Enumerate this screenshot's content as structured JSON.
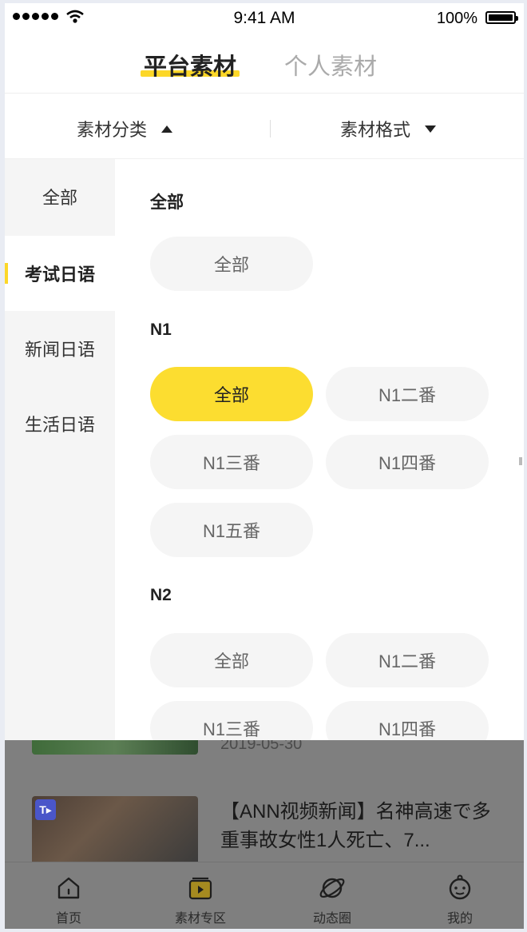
{
  "status_bar": {
    "time": "9:41 AM",
    "battery": "100%"
  },
  "tabs": {
    "active": "平台素材",
    "inactive": "个人素材"
  },
  "filters": {
    "category": "素材分类",
    "format": "素材格式"
  },
  "categories": [
    "全部",
    "考试日语",
    "新闻日语",
    "生活日语"
  ],
  "active_category": "考试日语",
  "sections": {
    "all": {
      "title": "全部",
      "chips": [
        "全部"
      ]
    },
    "n1": {
      "title": "N1",
      "chips": [
        "全部",
        "N1二番",
        "N1三番",
        "N1四番",
        "N1五番"
      ]
    },
    "n2": {
      "title": "N2",
      "chips": [
        "全部",
        "N1二番",
        "N1三番",
        "N1四番"
      ]
    }
  },
  "selected_chip": "N1 / 全部",
  "background": {
    "date": "2019-05-30",
    "news_title": "【ANN视频新闻】名神高速で多重事故女性1人死亡、7..."
  },
  "bottom_nav": [
    "首页",
    "素材专区",
    "动态圈",
    "我的"
  ],
  "colors": {
    "accent": "#fcd728",
    "chip": "#f5f5f5",
    "overlay": "#7f7f7f"
  }
}
